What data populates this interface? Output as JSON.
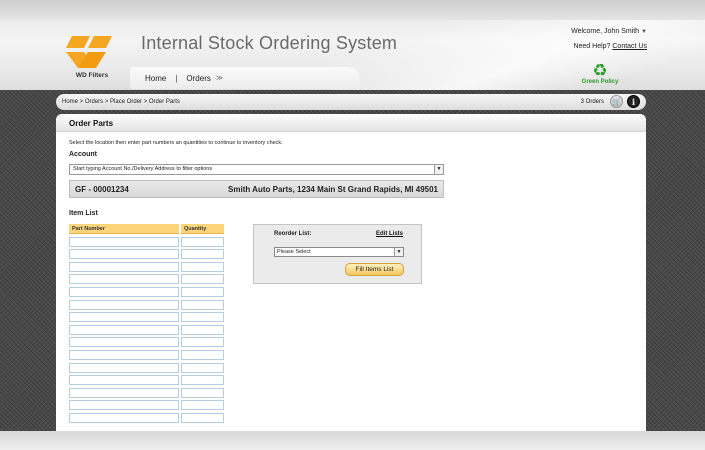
{
  "header": {
    "app_title": "Internal Stock Ordering System",
    "logo_text": "WD Filters",
    "welcome": "Welcome, John Smith",
    "help_prefix": "Need Help?",
    "help_link": "Contact Us",
    "green_policy": "Green Policy",
    "nav": {
      "home": "Home",
      "orders": "Orders"
    }
  },
  "breadcrumb": "Home > Orders > Place Order > Order Parts",
  "cart": {
    "orders_count": "3 Orders"
  },
  "panel": {
    "title": "Order Parts",
    "instructions": "Select the location then enter part numbers an quantities to continue to inventory check.",
    "account_label": "Account",
    "account_placeholder": "Start typing Account No./Delivery Address to filter options",
    "account_id": "GF - 00001234",
    "account_address": "Smith Auto Parts, 1234 Main St Grand Rapids, MI 49501",
    "item_list_label": "Item List",
    "columns": {
      "part_number": "Part Number",
      "quantity": "Quantity"
    }
  },
  "reorder": {
    "label": "Reorder List:",
    "edit": "Edit Lists",
    "select_value": "Please Select",
    "fill_button": "Fill Items List"
  },
  "colors": {
    "logo_orange": "#f5a623",
    "table_header": "#fcd47a",
    "fill_button": "#f7c75e",
    "green": "#2e9a2e"
  },
  "icons": [
    "recycle-icon",
    "cart-icon",
    "info-icon",
    "chevron-down-icon",
    "dropdown-arrow-icon"
  ]
}
